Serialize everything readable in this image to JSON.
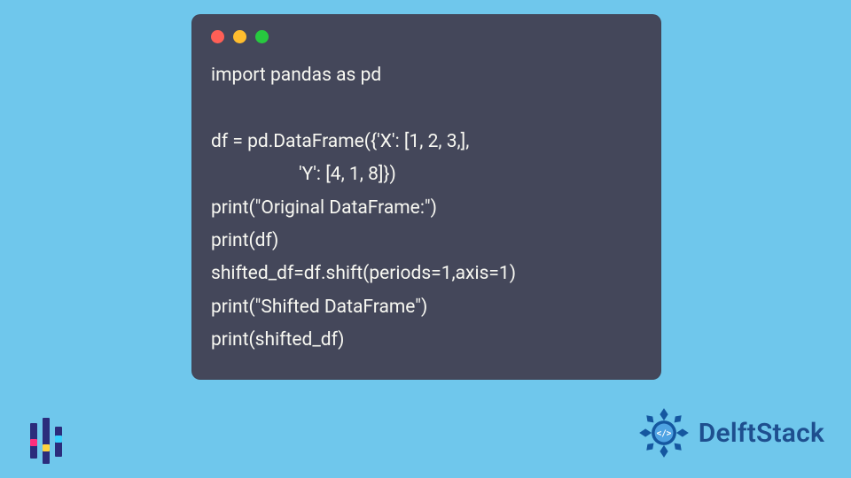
{
  "window": {
    "traffic_lights": [
      "red",
      "yellow",
      "green"
    ]
  },
  "code": {
    "lines": [
      "import pandas as pd",
      "",
      "df = pd.DataFrame({'X': [1, 2, 3,],",
      "                   'Y': [4, 1, 8]})",
      "print(\"Original DataFrame:\")",
      "print(df)",
      "shifted_df=df.shift(periods=1,axis=1)",
      "print(\"Shifted DataFrame\")",
      "print(shifted_df)"
    ]
  },
  "brand": {
    "name": "DelftStack"
  },
  "colors": {
    "page_bg": "#6fc7ec",
    "window_bg": "#44475a",
    "code_fg": "#f8f8f2",
    "brand_fg": "#1e4f8f",
    "medal_primary": "#1557a0",
    "medal_accent": "#4fa3e3"
  }
}
